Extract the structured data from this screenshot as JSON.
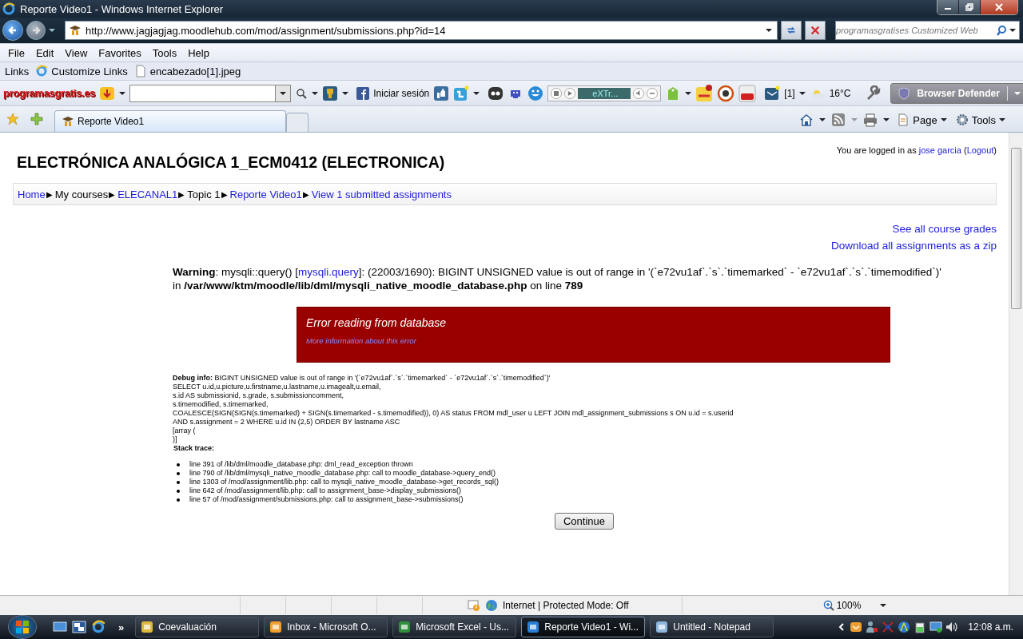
{
  "window": {
    "title": "Reporte Video1 - Windows Internet Explorer"
  },
  "address": {
    "url": "http://www.jagjagjag.moodlehub.com/mod/assignment/submissions.php?id=14",
    "search_placeholder": "programasgratises Customized Web"
  },
  "menu": [
    "File",
    "Edit",
    "View",
    "Favorites",
    "Tools",
    "Help"
  ],
  "links_bar": {
    "label": "Links",
    "items": [
      "Customize Links",
      "encabezado[1].jpeg"
    ]
  },
  "toolbar": {
    "logo": "programasgratis.es",
    "login": "Iniciar sesión",
    "player_display": "eXTr...",
    "mail_count": "[1]",
    "temperature": "16°C",
    "defender": "Browser Defender"
  },
  "tabs": [
    {
      "label": "Reporte Video1",
      "selected": true
    }
  ],
  "command_bar": [
    "Page",
    "Tools"
  ],
  "page": {
    "course_title": "ELECTRÓNICA ANALÓGICA 1_ECM0412 (ELECTRONICA)",
    "login": {
      "prefix": "You are logged in as",
      "user": "jose garcia",
      "open": "(",
      "logout": "Logout",
      "close": ")"
    },
    "breadcrumb": [
      {
        "label": "Home",
        "kind": "link",
        "sep": "▶"
      },
      {
        "label": "My courses",
        "kind": "text",
        "sep": "▶"
      },
      {
        "label": "ELECANAL1",
        "kind": "link",
        "sep": "▶"
      },
      {
        "label": "Topic 1",
        "kind": "text",
        "sep": "▶"
      },
      {
        "label": "Reporte Video1",
        "kind": "link",
        "sep": "▶"
      },
      {
        "label": "View 1 submitted assignments",
        "kind": "link"
      }
    ],
    "side_links": [
      "See all course grades",
      "Download all assignments as a zip"
    ],
    "warning": {
      "before": "**Warning**: mysqli::query() [",
      "link": "mysqli.query",
      "after": "]: (22003/1690): BIGINT UNSIGNED value is out of range in '(`e72vu1af`.`s`.`timemarked` - `e72vu1af`.`s`.`timemodified`)'",
      "line2": "in **/var/www/ktm/moodle/lib/dml/mysqli_native_moodle_database.php** on line **789**"
    },
    "error": {
      "title": "Error reading from database",
      "link": "More information about this error"
    },
    "debug": [
      "**Debug info:** BIGINT UNSIGNED value is out of range in '(`e72vu1af`.`s`.`timemarked` - `e72vu1af`.`s`.`timemodified`)'",
      "SELECT u.id,u.picture,u.firstname,u.lastname,u.imagealt,u.email,",
      "s.id AS submissionid, s.grade, s.submissioncomment,",
      "s.timemodified, s.timemarked,",
      "COALESCE(SIGN(SIGN(s.timemarked) + SIGN(s.timemarked - s.timemodified)), 0) AS status FROM mdl_user u LEFT JOIN mdl_assignment_submissions s ON u.id = s.userid",
      "AND s.assignment = 2 WHERE u.id IN (2,5) ORDER BY lastname ASC",
      "[array (",
      ")]"
    ],
    "stack_title": "Stack trace:",
    "stack": [
      "line 391 of /lib/dml/moodle_database.php: dml_read_exception thrown",
      "line 790 of /lib/dml/mysqli_native_moodle_database.php: call to moodle_database->query_end()",
      "line 1303 of /mod/assignment/lib.php: call to mysqli_native_moodle_database->get_records_sql()",
      "line 642 of /mod/assignment/lib.php: call to assignment_base->display_submissions()",
      "line 57 of /mod/assignment/submissions.php: call to assignment_base->submissions()"
    ],
    "continue": "Continue"
  },
  "status_bar": {
    "zone": "Internet | Protected Mode: Off",
    "zoom": "100%"
  },
  "taskbar": {
    "more": "»",
    "buttons": [
      {
        "label": "Coevaluación",
        "selected": false,
        "kind": "folder"
      },
      {
        "label": "Inbox - Microsoft O...",
        "selected": false,
        "kind": "mail"
      },
      {
        "label": "Microsoft Excel - Us...",
        "selected": false,
        "kind": "excel"
      },
      {
        "label": "Reporte Video1 - Wi...",
        "selected": true,
        "kind": "browser"
      },
      {
        "label": "Untitled - Notepad",
        "selected": false,
        "kind": "notepad"
      }
    ],
    "clock": "12:08 a.m."
  }
}
